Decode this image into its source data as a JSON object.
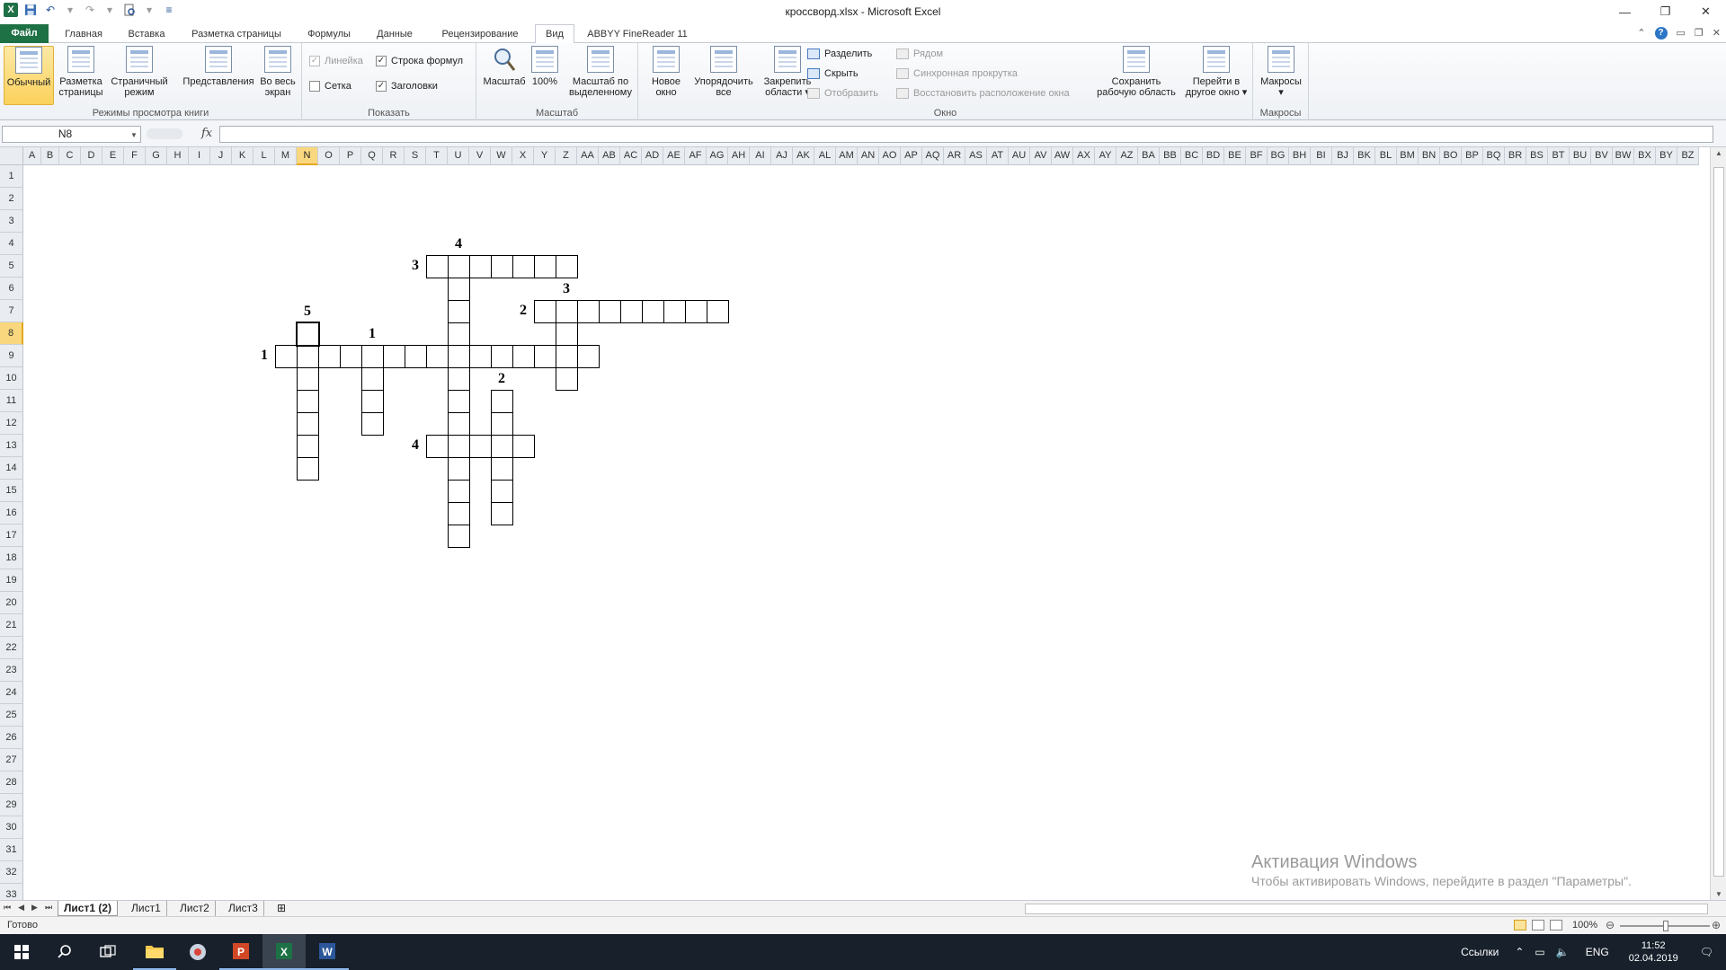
{
  "window": {
    "title": "кроссворд.xlsx - Microsoft Excel",
    "app_icon": "X",
    "controls": [
      "—",
      "❐",
      "✕"
    ]
  },
  "qat": {
    "icons": [
      "save-icon",
      "undo-icon",
      "redo-icon",
      "print-preview-icon",
      "customize-icon"
    ]
  },
  "tabs": [
    {
      "label": "Файл",
      "key": "file"
    },
    {
      "label": "Главная",
      "key": "home"
    },
    {
      "label": "Вставка",
      "key": "insert"
    },
    {
      "label": "Разметка страницы",
      "key": "page-layout"
    },
    {
      "label": "Формулы",
      "key": "formulas"
    },
    {
      "label": "Данные",
      "key": "data"
    },
    {
      "label": "Рецензирование",
      "key": "review"
    },
    {
      "label": "Вид",
      "key": "view"
    },
    {
      "label": "ABBYY FineReader 11",
      "key": "abbyy"
    }
  ],
  "ribbon": {
    "groups": {
      "views": "Режимы просмотра книги",
      "show": "Показать",
      "zoom": "Масштаб",
      "window": "Окно",
      "macros": "Макросы"
    },
    "views": {
      "normal": [
        "Обычный"
      ],
      "page_layout": [
        "Разметка",
        "страницы"
      ],
      "page_break": [
        "Страничный",
        "режим"
      ],
      "custom": [
        "Представления"
      ],
      "fullscreen": [
        "Во весь",
        "экран"
      ]
    },
    "show": {
      "ruler": {
        "label": "Линейка",
        "checked": true,
        "disabled": true
      },
      "gridlines": {
        "label": "Сетка",
        "checked": false
      },
      "formula_bar": {
        "label": "Строка формул",
        "checked": true
      },
      "headings": {
        "label": "Заголовки",
        "checked": true
      }
    },
    "zoom": {
      "zoom": [
        "Масштаб"
      ],
      "hundred": [
        "100%"
      ],
      "selection": [
        "Масштаб по",
        "выделенному"
      ]
    },
    "window": {
      "new_window": [
        "Новое",
        "окно"
      ],
      "arrange": [
        "Упорядочить",
        "все"
      ],
      "freeze": [
        "Закрепить",
        "области ▾"
      ],
      "split": "Разделить",
      "hide": "Скрыть",
      "unhide": "Отобразить",
      "side_by_side": "Рядом",
      "sync_scroll": "Синхронная прокрутка",
      "reset_position": "Восстановить расположение окна",
      "save_workspace": [
        "Сохранить",
        "рабочую область"
      ],
      "switch_windows": [
        "Перейти в",
        "другое окно ▾"
      ]
    },
    "macros": {
      "macros": [
        "Макросы",
        "▾"
      ]
    }
  },
  "formula_bar": {
    "name_box": "N8",
    "fx": "fx",
    "value": ""
  },
  "columns": [
    "A",
    "B",
    "C",
    "D",
    "E",
    "F",
    "G",
    "H",
    "I",
    "J",
    "K",
    "L",
    "M",
    "N",
    "O",
    "P",
    "Q",
    "R",
    "S",
    "T",
    "U",
    "V",
    "W",
    "X",
    "Y",
    "Z",
    "AA",
    "AB",
    "AC",
    "AD",
    "AE",
    "AF",
    "AG",
    "AH",
    "AI",
    "AJ",
    "AK",
    "AL",
    "AM",
    "AN",
    "AO",
    "AP",
    "AQ",
    "AR",
    "AS",
    "AT",
    "AU",
    "AV",
    "AW",
    "AX",
    "AY",
    "AZ",
    "BA",
    "BB",
    "BC",
    "BD",
    "BE",
    "BF",
    "BG",
    "BH",
    "BI",
    "BJ",
    "BK",
    "BL",
    "BM",
    "BN",
    "BO",
    "BP",
    "BQ",
    "BR",
    "BS",
    "BT",
    "BU",
    "BV",
    "BW",
    "BX",
    "BY",
    "BZ"
  ],
  "rows": [
    "1",
    "2",
    "3",
    "4",
    "5",
    "6",
    "7",
    "8",
    "9",
    "10",
    "11",
    "12",
    "13",
    "14",
    "15",
    "16",
    "17",
    "18",
    "19",
    "20",
    "21",
    "22",
    "23",
    "24",
    "25",
    "26",
    "27",
    "28",
    "29",
    "30",
    "31",
    "32",
    "33"
  ],
  "selected_cell": {
    "col": "N",
    "row": 8
  },
  "crossword": {
    "words": [
      {
        "label": "1",
        "dir": "across",
        "row": 9,
        "col": "M",
        "length": 15
      },
      {
        "label": "2",
        "dir": "across",
        "row": 7,
        "col": "Y",
        "length": 9
      },
      {
        "label": "3",
        "dir": "across",
        "row": 5,
        "col": "T",
        "length": 7
      },
      {
        "label": "4",
        "dir": "across",
        "row": 13,
        "col": "T",
        "length": 5
      },
      {
        "label": "1",
        "dir": "down",
        "row": 9,
        "col": "Q",
        "length": 4
      },
      {
        "label": "2",
        "dir": "down",
        "row": 11,
        "col": "W",
        "length": 6
      },
      {
        "label": "3",
        "dir": "down",
        "row": 7,
        "col": "Z",
        "length": 4
      },
      {
        "label": "4",
        "dir": "down",
        "row": 5,
        "col": "U",
        "length": 13
      },
      {
        "label": "5",
        "dir": "down",
        "row": 8,
        "col": "N",
        "length": 7
      }
    ]
  },
  "sheets": [
    {
      "name": "Лист1 (2)",
      "active": true
    },
    {
      "name": "Лист1",
      "active": false
    },
    {
      "name": "Лист2",
      "active": false
    },
    {
      "name": "Лист3",
      "active": false
    }
  ],
  "status": {
    "ready": "Готово",
    "zoom": "100%"
  },
  "watermark": {
    "title": "Активация Windows",
    "text": "Чтобы активировать Windows, перейдите в раздел \"Параметры\"."
  },
  "taskbar": {
    "apps": [
      "windows-start-icon",
      "search-icon",
      "task-view-icon",
      "file-explorer-icon",
      "browser-icon",
      "powerpoint-icon",
      "excel-icon",
      "word-icon"
    ],
    "links": "Ссылки",
    "lang": "ENG",
    "time": "11:52",
    "date": "02.04.2019"
  }
}
